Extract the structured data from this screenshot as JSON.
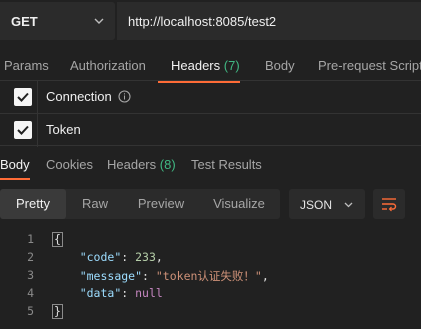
{
  "request": {
    "method": "GET",
    "url": "http://localhost:8085/test2"
  },
  "request_tabs": {
    "params": "Params",
    "authorization": "Authorization",
    "headers": "Headers",
    "headers_count": "(7)",
    "body": "Body",
    "pre_request": "Pre-request Script"
  },
  "headers_table": {
    "rows": [
      {
        "key": "Connection",
        "checked": true
      },
      {
        "key": "Token",
        "checked": true
      }
    ]
  },
  "response_tabs": {
    "body": "Body",
    "cookies": "Cookies",
    "headers": "Headers",
    "headers_count": "(8)",
    "test_results": "Test Results"
  },
  "view": {
    "pretty": "Pretty",
    "raw": "Raw",
    "preview": "Preview",
    "visualize": "Visualize",
    "format": "JSON"
  },
  "response_body": {
    "lines": [
      {
        "n": "1",
        "open": "{"
      },
      {
        "n": "2",
        "key": "\"code\"",
        "sep": ": ",
        "value": "233",
        "tail": ","
      },
      {
        "n": "3",
        "key": "\"message\"",
        "sep": ": ",
        "value": "\"token认证失败！\"",
        "tail": ","
      },
      {
        "n": "4",
        "key": "\"data\"",
        "sep": ": ",
        "value": "null",
        "tail": ""
      },
      {
        "n": "5",
        "close": "}"
      }
    ]
  },
  "colors": {
    "accent": "#ff6c37",
    "count": "#41b883",
    "background": "#212121"
  }
}
